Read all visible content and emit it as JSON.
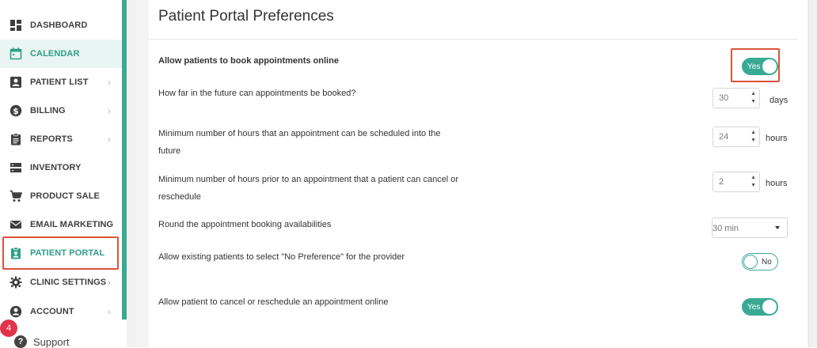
{
  "sidebar": {
    "items": [
      {
        "label": "DASHBOARD",
        "icon": "dashboard-icon"
      },
      {
        "label": "CALENDAR",
        "icon": "calendar-icon"
      },
      {
        "label": "PATIENT LIST",
        "icon": "patient-list-icon",
        "chevron": "›"
      },
      {
        "label": "BILLING",
        "icon": "dollar-icon",
        "chevron": "›"
      },
      {
        "label": "REPORTS",
        "icon": "clipboard-icon",
        "chevron": "›"
      },
      {
        "label": "INVENTORY",
        "icon": "inventory-icon"
      },
      {
        "label": "PRODUCT SALE",
        "icon": "cart-icon"
      },
      {
        "label": "EMAIL MARKETING",
        "icon": "mail-icon"
      },
      {
        "label": "PATIENT PORTAL",
        "icon": "portal-icon"
      },
      {
        "label": "CLINIC SETTINGS",
        "icon": "gear-icon",
        "chevron": "›"
      },
      {
        "label": "ACCOUNT",
        "icon": "account-icon",
        "chevron": "›"
      }
    ],
    "badge_count": "4",
    "support_label": "Support",
    "accent_color": "#3aa994",
    "highlight_color": "#d9533b"
  },
  "main": {
    "title": "Patient Portal Preferences",
    "settings": {
      "online_booking": {
        "label": "Allow patients to book appointments online",
        "toggle": "Yes"
      },
      "booking_horizon": {
        "label": "How far in the future can appointments be booked?",
        "value": "30",
        "unit": "days"
      },
      "min_hours_schedule": {
        "label_line1": "Minimum number of hours that an appointment can be scheduled into the",
        "label_line2": "future",
        "value": "24",
        "unit": "hours"
      },
      "min_hours_cancel": {
        "label_line1": "Minimum number of hours prior to an appointment that a patient can cancel or",
        "label_line2": "reschedule",
        "value": "2",
        "unit": "hours"
      },
      "round_availability": {
        "label": "Round the appointment booking availabilities",
        "selected": "30 min"
      },
      "no_preference": {
        "label": "Allow existing patients to select \"No Preference\" for the provider",
        "toggle": "No"
      },
      "cancel_online": {
        "label": "Allow patient to cancel or reschedule an appointment online",
        "toggle": "Yes"
      }
    }
  }
}
